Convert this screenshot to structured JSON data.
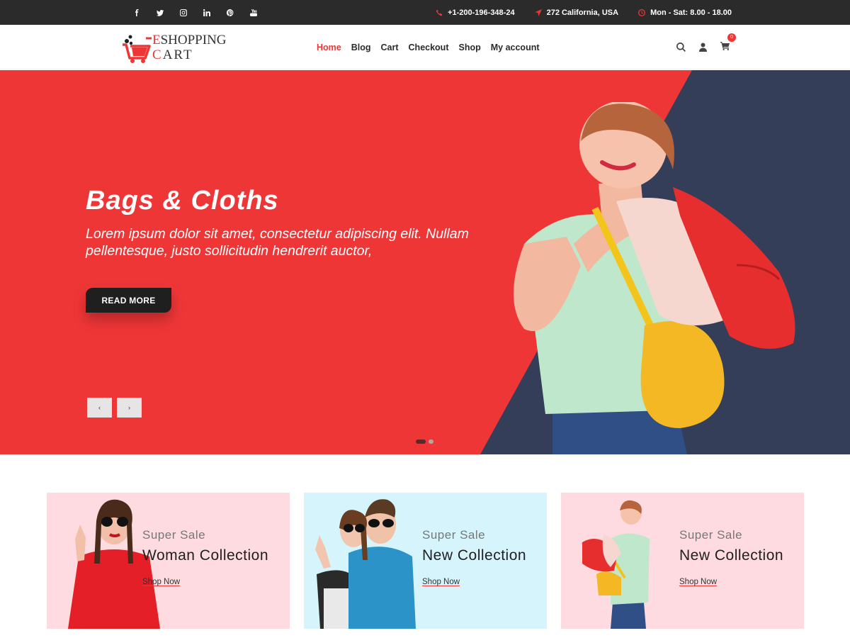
{
  "topbar": {
    "social": [
      "facebook-icon",
      "twitter-icon",
      "instagram-icon",
      "linkedin-icon",
      "pinterest-icon",
      "youtube-icon"
    ],
    "phone": "+1-200-196-348-24",
    "address": "272 California, USA",
    "hours": "Mon - Sat: 8.00 - 18.00"
  },
  "logo": {
    "line1_first": "E",
    "line1_rest": "SHOPPING",
    "line2_first": "C",
    "line2_rest": "ART"
  },
  "nav": {
    "items": [
      "Home",
      "Blog",
      "Cart",
      "Checkout",
      "Shop",
      "My account"
    ],
    "active": "Home"
  },
  "header_icons": {
    "cart_count": "0"
  },
  "hero": {
    "title": "Bags & Cloths",
    "text": "Lorem ipsum dolor sit amet, consectetur adipiscing elit. Nullam pellentesque, justo sollicitudin hendrerit auctor,",
    "button": "READ MORE",
    "prev": "‹",
    "next": "›",
    "slides": 2,
    "active_slide": 1
  },
  "banners": [
    {
      "sub": "Super Sale",
      "title": "Woman Collection",
      "link": "Shop Now",
      "bg": "#fddbe0"
    },
    {
      "sub": "Super Sale",
      "title": "New Collection",
      "link": "Shop Now",
      "bg": "#d6f4fb"
    },
    {
      "sub": "Super Sale",
      "title": "New Collection",
      "link": "Shop Now",
      "bg": "#fddbe0"
    }
  ],
  "colors": {
    "accent": "#ef3637",
    "dark_panel": "#353e59",
    "topbar": "#2b2b2b"
  }
}
